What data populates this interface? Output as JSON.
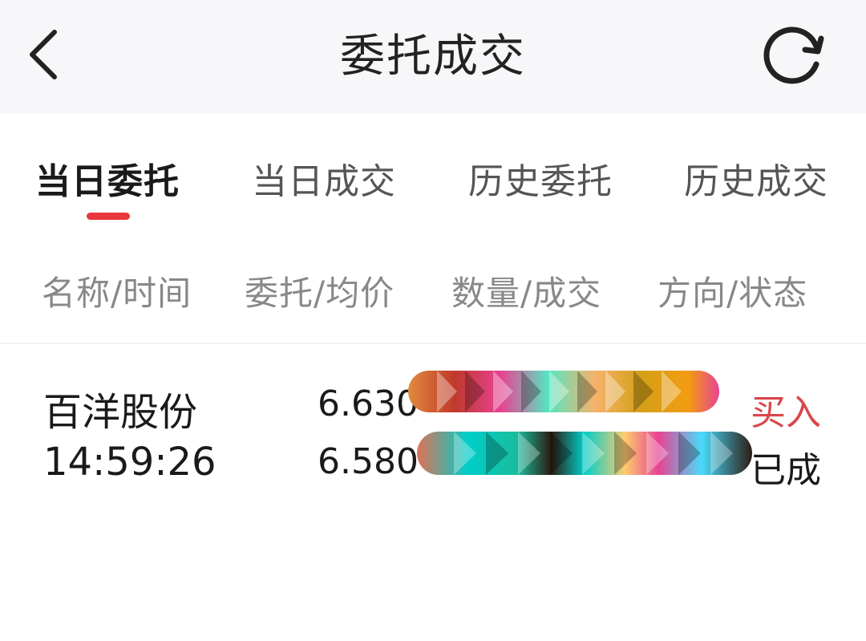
{
  "header": {
    "title": "委托成交",
    "back_icon": "chevron-left-icon",
    "refresh_icon": "refresh-icon"
  },
  "tabs": [
    {
      "label": "当日委托",
      "active": true
    },
    {
      "label": "当日成交",
      "active": false
    },
    {
      "label": "历史委托",
      "active": false
    },
    {
      "label": "历史成交",
      "active": false
    }
  ],
  "columns": [
    "名称/时间",
    "委托/均价",
    "数量/成交",
    "方向/状态"
  ],
  "orders": [
    {
      "name": "百洋股份",
      "time": "14:59:26",
      "order_price": "6.630",
      "avg_price": "6.580",
      "quantity": "",
      "filled": "",
      "direction": "买入",
      "status": "已成"
    }
  ],
  "colors": {
    "accent_red": "#e8383c",
    "buy_red": "#d9464a",
    "header_bg": "#f7f7f9"
  }
}
